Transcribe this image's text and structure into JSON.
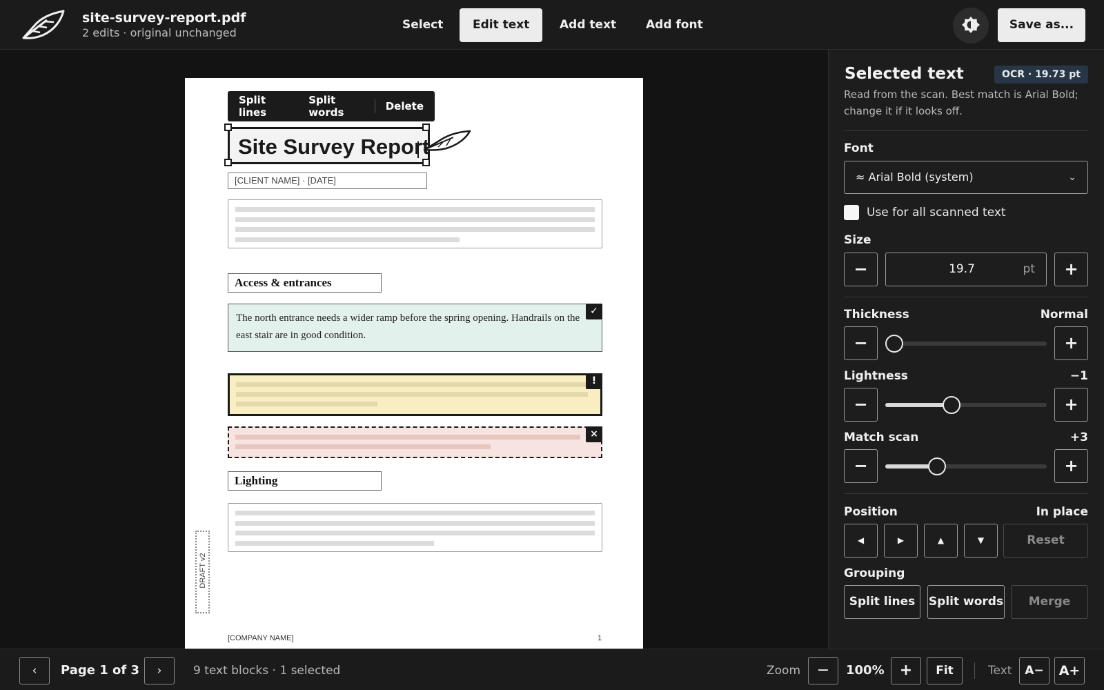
{
  "header": {
    "file_name": "site-survey-report.pdf",
    "file_status": "2 edits · original unchanged",
    "tools": {
      "select": "Select",
      "edit_text": "Edit text",
      "add_text": "Add text",
      "add_font": "Add font"
    },
    "active_tool": "Edit text",
    "save_label": "Save as..."
  },
  "document": {
    "context_menu": {
      "split_lines": "Split lines",
      "split_words": "Split words",
      "delete": "Delete"
    },
    "selected_title": "Site Survey Report",
    "client_placeholder": "[CLIENT NAME] · [DATE]",
    "section_access": "Access & entrances",
    "access_text": "The north entrance needs a wider ramp before the spring opening. Handrails on the east stair are in good condition.",
    "badge_ok": "✓",
    "badge_warn": "!",
    "badge_error": "×",
    "section_lighting": "Lighting",
    "draft_label": "DRAFT v2",
    "footer_company": "[COMPANY NAME]",
    "footer_page": "1"
  },
  "panel": {
    "title": "Selected text",
    "ocr_badge": "OCR · 19.73 pt",
    "note": "Read from the scan. Best match is Arial Bold; change it if it looks off.",
    "font_label": "Font",
    "font_value": "≈ Arial Bold (system)",
    "use_all_label": "Use for all scanned text",
    "use_all_checked": false,
    "size_label": "Size",
    "size_value": "19.7",
    "size_unit": "pt",
    "thickness_label": "Thickness",
    "thickness_value": "Normal",
    "thickness_level": 0.0,
    "lightness_label": "Lightness",
    "lightness_value": "−1",
    "lightness_level": 0.41,
    "match_label": "Match scan",
    "match_value": "+3",
    "match_level": 0.32,
    "position_label": "Position",
    "position_value": "In place",
    "reset_label": "Reset",
    "grouping_label": "Grouping",
    "group_split_lines": "Split lines",
    "group_split_words": "Split words",
    "group_merge": "Merge"
  },
  "statusbar": {
    "page_indicator": "Page 1 of 3",
    "blocks": "9 text blocks · 1 selected",
    "zoom_label": "Zoom",
    "zoom_value": "100%",
    "fit_label": "Fit",
    "text_label": "Text",
    "text_smaller": "A−",
    "text_larger": "A+"
  },
  "colors": {
    "accent_dark": "#1b1b1b",
    "ok_fill": "#e2f1ec",
    "warn_fill": "#f8eec2",
    "error_fill": "#f7e3df",
    "ocr_badge": "#273545"
  }
}
